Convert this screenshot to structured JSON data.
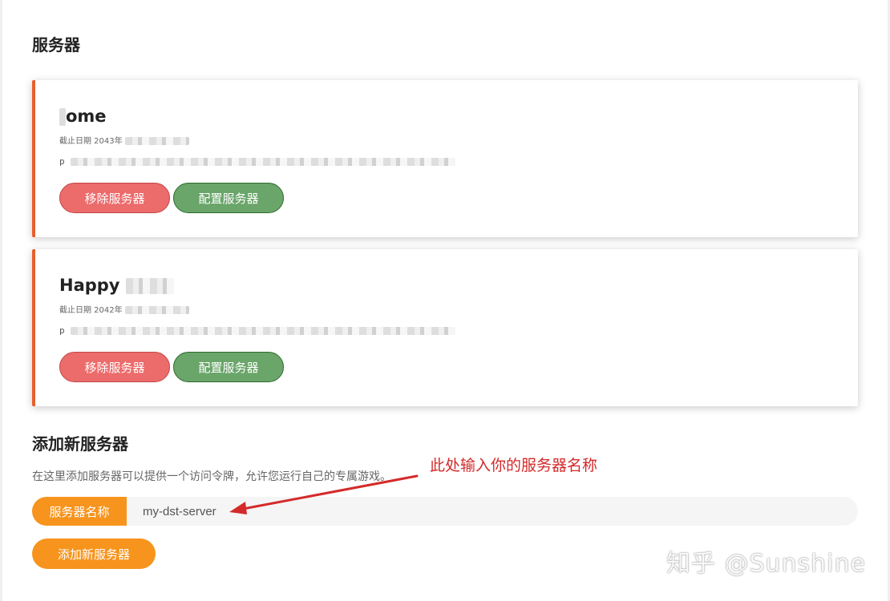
{
  "servers_section": {
    "title": "服务器"
  },
  "servers": [
    {
      "name": "ome",
      "expiry_label": "截止日期 2043年",
      "token_visible": "p",
      "remove_label": "移除服务器",
      "config_label": "配置服务器"
    },
    {
      "name": "Happy",
      "expiry_label": "截止日期 2042年",
      "token_visible": "p",
      "remove_label": "移除服务器",
      "config_label": "配置服务器"
    }
  ],
  "add_section": {
    "title": "添加新服务器",
    "description": "在这里添加服务器可以提供一个访问令牌，允许您运行自己的专属游戏。",
    "input_label": "服务器名称",
    "input_value": "my-dst-server",
    "add_button_label": "添加新服务器"
  },
  "annotation": {
    "text": "此处输入你的服务器名称",
    "color": "#d42a2a"
  },
  "watermark": {
    "text": "知乎 @Sunshine"
  },
  "colors": {
    "accent_orange": "#f7941d",
    "card_border": "#e7602f",
    "remove_red": "#ec6b6b",
    "config_green": "#6aa56a"
  }
}
